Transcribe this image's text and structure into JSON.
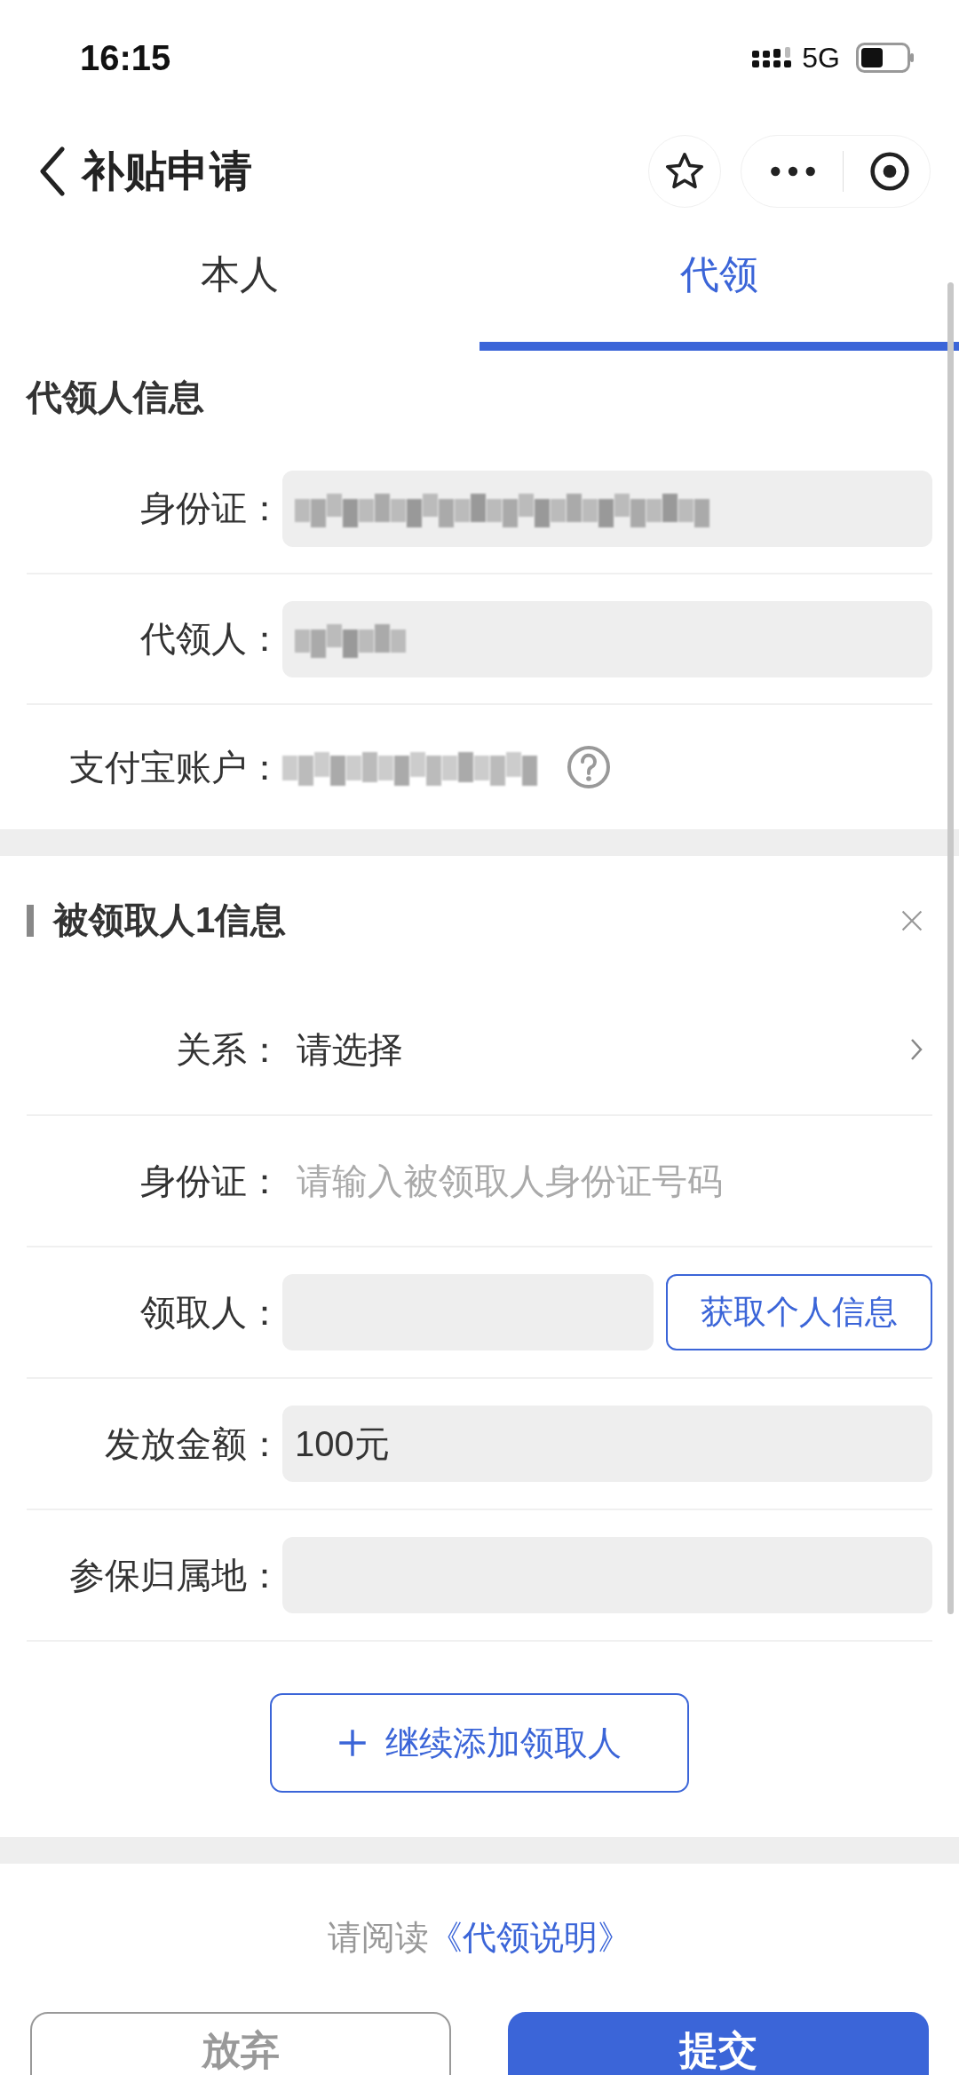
{
  "status_bar": {
    "time": "16:15",
    "network": "5G"
  },
  "nav": {
    "title": "补贴申请"
  },
  "tabs": [
    {
      "label": "本人",
      "selected": false
    },
    {
      "label": "代领",
      "selected": true
    }
  ],
  "agent_section": {
    "title": "代领人信息",
    "rows": [
      {
        "label": "身份证：",
        "kind": "masked-field",
        "help": false
      },
      {
        "label": "代领人：",
        "kind": "masked-field",
        "help": false
      },
      {
        "label": "支付宝账户：",
        "kind": "masked-text",
        "help": true
      }
    ]
  },
  "recipient_section": {
    "title": "被领取人1信息",
    "rows": [
      {
        "label": "关系：",
        "kind": "select",
        "value": "请选择"
      },
      {
        "label": "身份证：",
        "kind": "input",
        "placeholder": "请输入被领取人身份证号码"
      },
      {
        "label": "领取人：",
        "kind": "field-button",
        "value": "",
        "button": "获取个人信息"
      },
      {
        "label": "发放金额：",
        "kind": "field",
        "value": "100元"
      },
      {
        "label": "参保归属地：",
        "kind": "field",
        "value": ""
      }
    ],
    "add_button": "继续添加领取人"
  },
  "notice": {
    "text": "请阅读",
    "link": "《代领说明》"
  },
  "buttons": [
    {
      "label": "放弃",
      "kind": "secondary"
    },
    {
      "label": "提交",
      "kind": "primary"
    }
  ]
}
